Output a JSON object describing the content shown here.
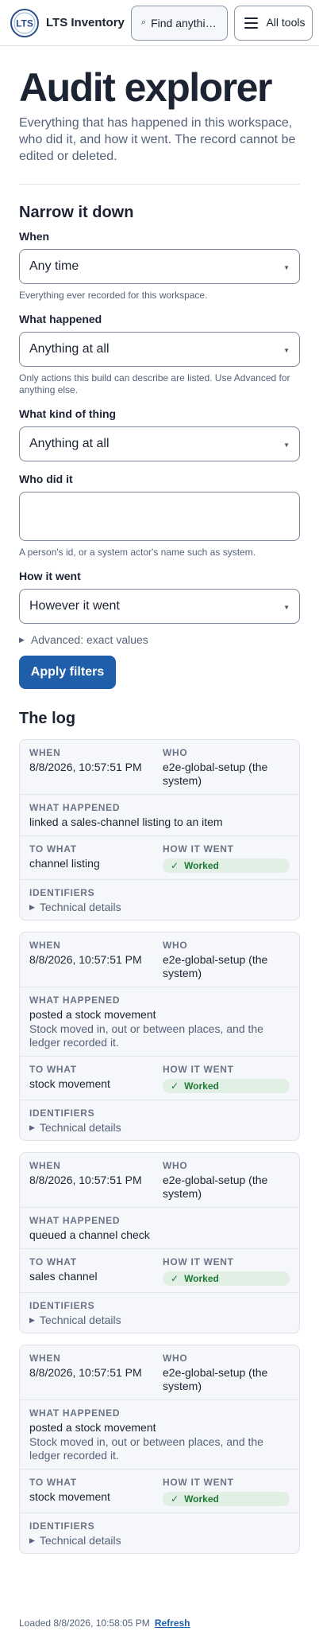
{
  "header": {
    "brand": "LTS Inventory",
    "logo_text": "LTS",
    "search_label": "Find anything…",
    "tools_label": "All tools"
  },
  "page": {
    "title": "Audit explorer",
    "lede": "Everything that has happened in this workspace, who did it, and how it went. The record cannot be edited or deleted."
  },
  "filters": {
    "heading": "Narrow it down",
    "when": {
      "label": "When",
      "value": "Any time",
      "hint": "Everything ever recorded for this workspace."
    },
    "what": {
      "label": "What happened",
      "value": "Anything at all",
      "hint": "Only actions this build can describe are listed. Use Advanced for anything else."
    },
    "kind": {
      "label": "What kind of thing",
      "value": "Anything at all"
    },
    "who": {
      "label": "Who did it",
      "value": "",
      "hint": "A person's id, or a system actor's name such as system."
    },
    "outcome": {
      "label": "How it went",
      "value": "However it went"
    },
    "advanced_label": "Advanced: exact values",
    "apply_label": "Apply filters"
  },
  "log": {
    "heading": "The log",
    "labels": {
      "when": "WHEN",
      "who": "WHO",
      "what": "WHAT HAPPENED",
      "to_what": "TO WHAT",
      "how": "HOW IT WENT",
      "ids": "IDENTIFIERS",
      "tech": "Technical details"
    },
    "entries": [
      {
        "when": "8/8/2026, 10:57:51 PM",
        "who": "e2e-global-setup (the system)",
        "what": "linked a sales-channel listing to an item",
        "desc": "",
        "target": "channel listing",
        "status": "Worked"
      },
      {
        "when": "8/8/2026, 10:57:51 PM",
        "who": "e2e-global-setup (the system)",
        "what": "posted a stock movement",
        "desc": "Stock moved in, out or between places, and the ledger recorded it.",
        "target": "stock movement",
        "status": "Worked"
      },
      {
        "when": "8/8/2026, 10:57:51 PM",
        "who": "e2e-global-setup (the system)",
        "what": "queued a channel check",
        "desc": "",
        "target": "sales channel",
        "status": "Worked"
      },
      {
        "when": "8/8/2026, 10:57:51 PM",
        "who": "e2e-global-setup (the system)",
        "what": "posted a stock movement",
        "desc": "Stock moved in, out or between places, and the ledger recorded it.",
        "target": "stock movement",
        "status": "Worked"
      }
    ]
  },
  "footer": {
    "loaded": "Loaded 8/8/2026, 10:58:05 PM",
    "refresh": "Refresh"
  },
  "colors": {
    "primary": "#1f5ea8",
    "success_bg": "#e1efe4",
    "success_text": "#1e7a35",
    "text": "#1c2333",
    "muted": "#55627a"
  }
}
